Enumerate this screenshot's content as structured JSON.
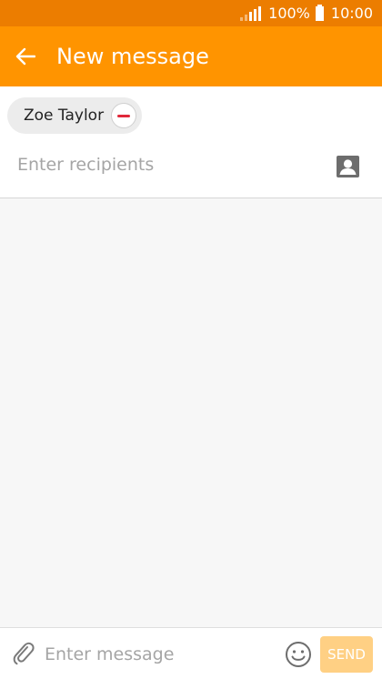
{
  "status_bar": {
    "battery_percent": "100%",
    "time": "10:00",
    "icons": [
      "signal-icon",
      "battery-icon"
    ]
  },
  "app_bar": {
    "title": "New message",
    "back_icon": "arrow-left-icon"
  },
  "recipients": {
    "chips": [
      {
        "label": "Zoe Taylor",
        "remove_icon": "remove-minus-icon"
      }
    ],
    "input_placeholder": "Enter recipients",
    "contact_icon": "contact-card-icon"
  },
  "composer": {
    "attach_icon": "paperclip-icon",
    "input_placeholder": "Enter message",
    "emoji_icon": "smiley-icon",
    "send_label": "SEND"
  },
  "colors": {
    "status_bar": "#ec7d00",
    "app_bar": "#ff9400",
    "send_disabled": "#ffd084",
    "remove_accent": "#e0283a"
  }
}
